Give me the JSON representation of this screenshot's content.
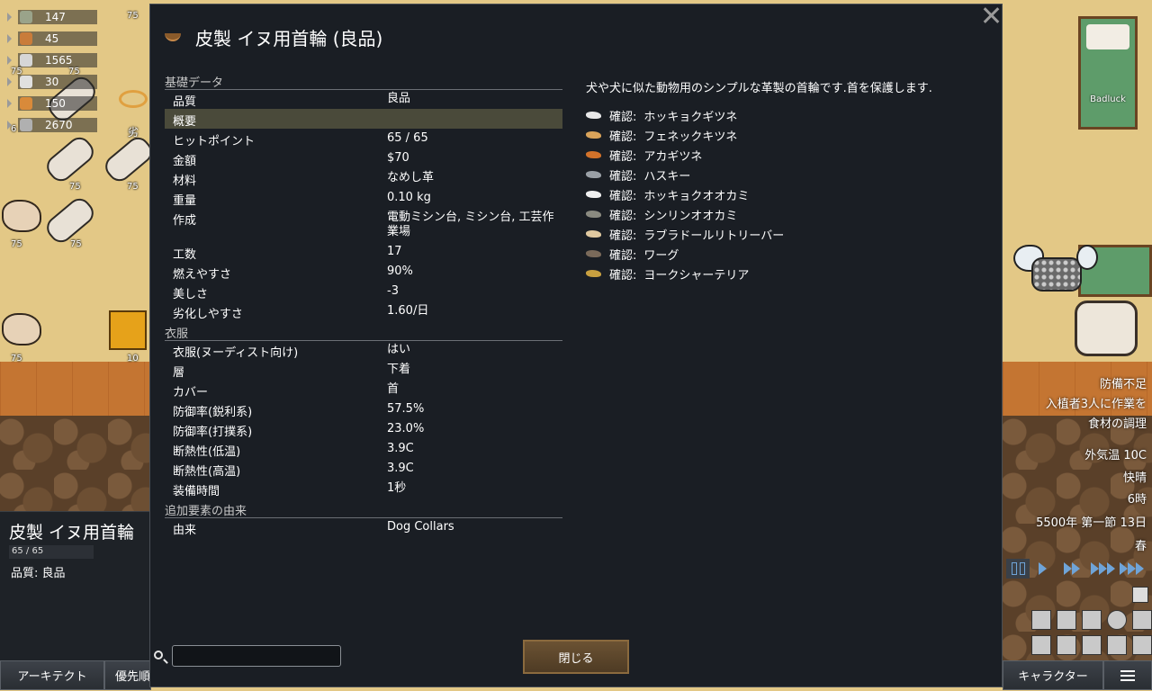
{
  "dialog": {
    "title": "皮製 イヌ用首輪 (良品)",
    "sections": [
      {
        "header": "基礎データ",
        "rows": [
          {
            "label": "品質",
            "value": "良品"
          },
          {
            "label": "概要",
            "value": ""
          },
          {
            "label": "ヒットポイント",
            "value": "65 / 65"
          },
          {
            "label": "金額",
            "value": "$70"
          },
          {
            "label": "材料",
            "value": "なめし革"
          },
          {
            "label": "重量",
            "value": "0.10 kg"
          },
          {
            "label": "作成",
            "value": "電動ミシン台, ミシン台, 工芸作業場"
          },
          {
            "label": "工数",
            "value": "17"
          },
          {
            "label": "燃えやすさ",
            "value": "90%"
          },
          {
            "label": "美しさ",
            "value": "-3"
          },
          {
            "label": "劣化しやすさ",
            "value": "1.60/日"
          }
        ]
      },
      {
        "header": "衣服",
        "rows": [
          {
            "label": "衣服(ヌーディスト向け)",
            "value": "はい"
          },
          {
            "label": "層",
            "value": "下着"
          },
          {
            "label": "カバー",
            "value": "首"
          },
          {
            "label": "防御率(鋭利系)",
            "value": "57.5%"
          },
          {
            "label": "防御率(打撲系)",
            "value": "23.0%"
          },
          {
            "label": "断熱性(低温)",
            "value": "3.9C"
          },
          {
            "label": "断熱性(高温)",
            "value": "3.9C"
          },
          {
            "label": "装備時間",
            "value": "1秒"
          }
        ]
      },
      {
        "header": "追加要素の由来",
        "rows": [
          {
            "label": "由来",
            "value": "Dog Collars"
          }
        ]
      }
    ],
    "description": "犬や犬に似た動物用のシンプルな革製の首輪です.首を保護します.",
    "confirm_prefix": "確認:",
    "animals": [
      {
        "name": "ホッキョクギツネ",
        "color": "#e8e8e8"
      },
      {
        "name": "フェネックキツネ",
        "color": "#d9a35a"
      },
      {
        "name": "アカギツネ",
        "color": "#d2722a"
      },
      {
        "name": "ハスキー",
        "color": "#9aa0a6"
      },
      {
        "name": "ホッキョクオオカミ",
        "color": "#f0f0f0"
      },
      {
        "name": "シンリンオオカミ",
        "color": "#8a8a80"
      },
      {
        "name": "ラブラドールリトリーバー",
        "color": "#e0c9a0"
      },
      {
        "name": "ワーグ",
        "color": "#7a6a5a"
      },
      {
        "name": "ヨークシャーテリア",
        "color": "#c8a040"
      }
    ],
    "close_label": "閉じる",
    "search_value": ""
  },
  "resources": [
    {
      "value": "147",
      "color": "#9aa38a"
    },
    {
      "value": "45",
      "color": "#c97c3a"
    },
    {
      "value": "1565",
      "color": "#d6d6d6"
    },
    {
      "value": "30",
      "color": "#e0e0e0"
    },
    {
      "value": "150",
      "color": "#d98a3a"
    },
    {
      "value": "2670",
      "color": "#b0b0b0"
    }
  ],
  "map_labels": {
    "stack": "75",
    "small_stack": "10",
    "partial_count": "6",
    "bed_owner": "Badluck",
    "corner_kanji": "劣"
  },
  "alerts": [
    "防備不足",
    "入植者3人に作業を",
    "食材の調理"
  ],
  "environment": {
    "temperature": "外気温 10C",
    "weather": "快晴",
    "hour": "6時",
    "date": "5500年 第一節 13日",
    "season": "春"
  },
  "inspect": {
    "title": "皮製 イヌ用首輪",
    "hp": "65 / 65",
    "hp_fraction": 1.0,
    "quality": "品質: 良品"
  },
  "bottom_tabs": {
    "architect": "アーキテクト",
    "priority": "優先順",
    "character": "キャラクター"
  },
  "colors": {
    "dialog_bg": "#1a1e24",
    "highlight_row": "#4a4a3a",
    "button": "#6b5233",
    "speed_accent": "#6fa4d8"
  }
}
